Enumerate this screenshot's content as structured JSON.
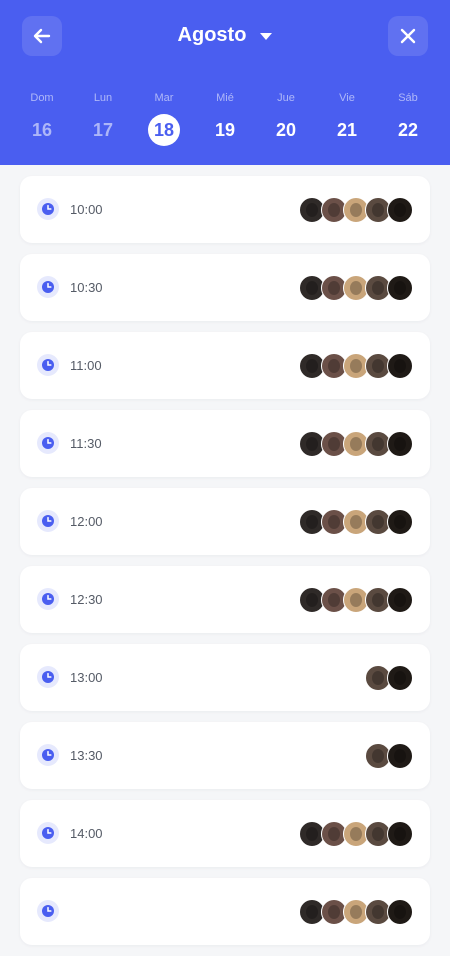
{
  "header": {
    "month_label": "Agosto",
    "back_icon": "arrow-left-icon",
    "close_icon": "close-icon",
    "accent": "#4a5ef0"
  },
  "days": [
    {
      "name": "Dom",
      "num": "16",
      "state": "past"
    },
    {
      "name": "Lun",
      "num": "17",
      "state": "past"
    },
    {
      "name": "Mar",
      "num": "18",
      "state": "selected"
    },
    {
      "name": "Mié",
      "num": "19",
      "state": "future"
    },
    {
      "name": "Jue",
      "num": "20",
      "state": "future"
    },
    {
      "name": "Vie",
      "num": "21",
      "state": "future"
    },
    {
      "name": "Sáb",
      "num": "22",
      "state": "future"
    }
  ],
  "slots": [
    {
      "time": "10:00",
      "avatars": 5
    },
    {
      "time": "10:30",
      "avatars": 5
    },
    {
      "time": "11:00",
      "avatars": 5
    },
    {
      "time": "11:30",
      "avatars": 5
    },
    {
      "time": "12:00",
      "avatars": 5
    },
    {
      "time": "12:30",
      "avatars": 5
    },
    {
      "time": "13:00",
      "avatars": 2
    },
    {
      "time": "13:30",
      "avatars": 2
    },
    {
      "time": "14:00",
      "avatars": 5
    },
    {
      "time": "",
      "avatars": 5
    }
  ],
  "avatar_colors": [
    "#2f2a28",
    "#6b5048",
    "#c9a57a",
    "#5a4a40",
    "#1f1a16"
  ]
}
